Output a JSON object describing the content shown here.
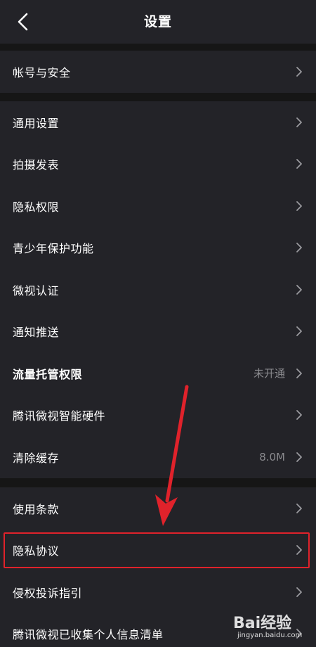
{
  "header": {
    "title": "设置"
  },
  "sections": [
    {
      "items": [
        {
          "label": "帐号与安全"
        }
      ]
    },
    {
      "items": [
        {
          "label": "通用设置"
        },
        {
          "label": "拍摄发表"
        },
        {
          "label": "隐私权限"
        },
        {
          "label": "青少年保护功能"
        },
        {
          "label": "微视认证"
        },
        {
          "label": "通知推送"
        },
        {
          "label": "流量托管权限",
          "value": "未开通"
        },
        {
          "label": "腾讯微视智能硬件"
        },
        {
          "label": "清除缓存",
          "value": "8.0M"
        }
      ]
    },
    {
      "items": [
        {
          "label": "使用条款"
        },
        {
          "label": "隐私协议"
        },
        {
          "label": "侵权投诉指引"
        },
        {
          "label": "腾讯微视已收集个人信息清单"
        }
      ]
    }
  ],
  "annotation": {
    "color": "#e0222b"
  },
  "watermark": {
    "text": "Bai经验",
    "url": "jingyan.baidu.com"
  }
}
